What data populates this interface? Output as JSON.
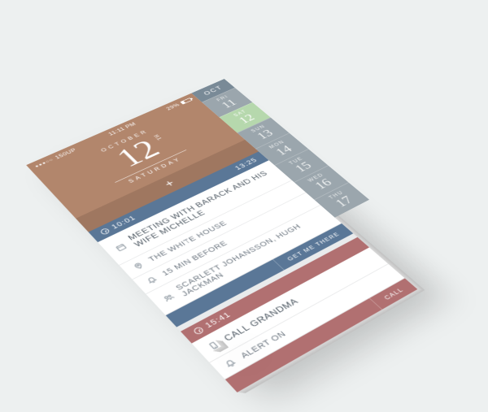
{
  "statusbar": {
    "carrier": "150UP",
    "time": "11:11 PM",
    "battery_pct": "29%"
  },
  "hero": {
    "month_label": "OCTOBER",
    "day_num": "12",
    "ordinal": "TH",
    "weekday": "SATURDAY"
  },
  "add_label": "+",
  "events": [
    {
      "start": "10:01",
      "end": "13:25",
      "title": "MEETING WITH BARACK AND HIS WIFE MICHELLE",
      "location": "THE WHITE HOUSE",
      "reminder": "15 MIN BEFORE",
      "attendees": "SCARLETT JOHANSSON, HUGH JACKMAN",
      "action": "GET ME THERE",
      "color": "blue"
    },
    {
      "start": "15:41",
      "end": "",
      "title": "CALL GRANDMA",
      "alert": "ALERT ON",
      "action": "CALL",
      "color": "red"
    }
  ],
  "sidecal": {
    "month": "OCT",
    "days": [
      {
        "dow": "FRI",
        "num": "11"
      },
      {
        "dow": "SAT",
        "num": "12",
        "active": true
      },
      {
        "dow": "SUN",
        "num": "13"
      },
      {
        "dow": "MON",
        "num": "14"
      },
      {
        "dow": "TUE",
        "num": "15"
      },
      {
        "dow": "WED",
        "num": "16"
      },
      {
        "dow": "THU",
        "num": "17"
      }
    ]
  }
}
